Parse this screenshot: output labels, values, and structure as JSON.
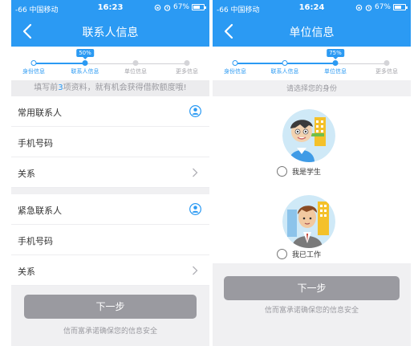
{
  "status_left": {
    "carrier": "-66 中国移动",
    "time": "16:23",
    "battery": "67%",
    "battery_level": 0.67
  },
  "status_right": {
    "carrier": "-66 中国移动",
    "time": "16:24",
    "battery": "67%",
    "battery_level": 0.67
  },
  "left_screen": {
    "title": "联系人信息",
    "progress": {
      "percent": "50%",
      "steps": [
        "身份信息",
        "联系人信息",
        "单位信息",
        "更多信息"
      ]
    },
    "hint_prefix": "填写前",
    "hint_number": "3",
    "hint_suffix": "项资料，就有机会获得借款额度哦!",
    "contact_group_1": {
      "name_label": "常用联系人",
      "phone_label": "手机号码",
      "relation_label": "关系"
    },
    "contact_group_2": {
      "name_label": "紧急联系人",
      "phone_label": "手机号码",
      "relation_label": "关系"
    },
    "next_button": "下一步",
    "footnote": "信而富承诺确保您的信息安全"
  },
  "right_screen": {
    "title": "单位信息",
    "progress": {
      "percent": "75%",
      "steps": [
        "身份信息",
        "联系人信息",
        "单位信息",
        "更多信息"
      ]
    },
    "choose_hint": "请选择您的身份",
    "options": {
      "student": "我是学生",
      "worker": "我已工作"
    },
    "next_button": "下一步",
    "footnote": "信而富承诺确保您的信息安全"
  },
  "colors": {
    "brand_blue": "#2b9af3",
    "button_gray": "#9a9aa0"
  },
  "icons": {
    "back": "chevron-left-icon",
    "contact": "contact-person-icon",
    "chevron": "chevron-right-icon",
    "wifi": "wifi-icon",
    "alarm": "alarm-icon",
    "battery": "battery-icon"
  }
}
